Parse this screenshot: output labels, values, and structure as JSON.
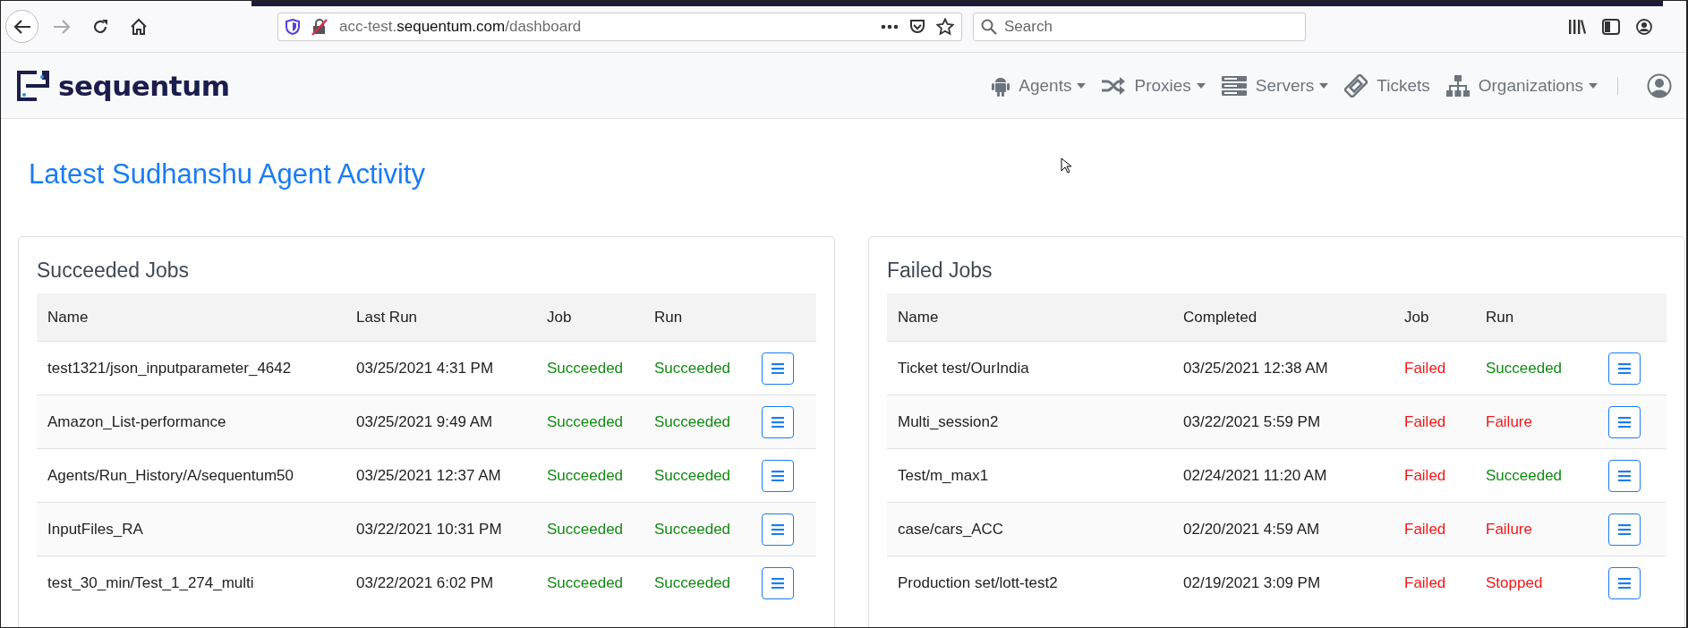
{
  "browser": {
    "url": {
      "prefix": "acc-test.",
      "domain": "sequentum.com",
      "path": "/dashboard"
    },
    "search": {
      "placeholder": "Search"
    }
  },
  "navbar": {
    "brand": "sequentum",
    "items": [
      {
        "label": "Agents",
        "dropdown": true
      },
      {
        "label": "Proxies",
        "dropdown": true
      },
      {
        "label": "Servers",
        "dropdown": true
      },
      {
        "label": "Tickets",
        "dropdown": false
      },
      {
        "label": "Organizations",
        "dropdown": true
      }
    ]
  },
  "page_title": "Latest Sudhanshu Agent Activity",
  "panels": [
    {
      "title": "Succeeded Jobs",
      "columns": [
        "Name",
        "Last Run",
        "Job",
        "Run"
      ],
      "rows": [
        {
          "name": "test1321/json_inputparameter_4642",
          "time": "03/25/2021 4:31 PM",
          "job": {
            "text": "Succeeded",
            "kind": "ok"
          },
          "run": {
            "text": "Succeeded",
            "kind": "ok"
          }
        },
        {
          "name": "Amazon_List-performance",
          "time": "03/25/2021 9:49 AM",
          "job": {
            "text": "Succeeded",
            "kind": "ok"
          },
          "run": {
            "text": "Succeeded",
            "kind": "ok"
          }
        },
        {
          "name": "Agents/Run_History/A/sequentum50",
          "time": "03/25/2021 12:37 AM",
          "job": {
            "text": "Succeeded",
            "kind": "ok"
          },
          "run": {
            "text": "Succeeded",
            "kind": "ok"
          }
        },
        {
          "name": "InputFiles_RA",
          "time": "03/22/2021 10:31 PM",
          "job": {
            "text": "Succeeded",
            "kind": "ok"
          },
          "run": {
            "text": "Succeeded",
            "kind": "ok"
          }
        },
        {
          "name": "test_30_min/Test_1_274_multi",
          "time": "03/22/2021 6:02 PM",
          "job": {
            "text": "Succeeded",
            "kind": "ok"
          },
          "run": {
            "text": "Succeeded",
            "kind": "ok"
          }
        }
      ]
    },
    {
      "title": "Failed Jobs",
      "columns": [
        "Name",
        "Completed",
        "Job",
        "Run"
      ],
      "rows": [
        {
          "name": "Ticket test/OurIndia",
          "time": "03/25/2021 12:38 AM",
          "job": {
            "text": "Failed",
            "kind": "fail"
          },
          "run": {
            "text": "Succeeded",
            "kind": "ok"
          }
        },
        {
          "name": "Multi_session2",
          "time": "03/22/2021 5:59 PM",
          "job": {
            "text": "Failed",
            "kind": "fail"
          },
          "run": {
            "text": "Failure",
            "kind": "fail"
          }
        },
        {
          "name": "Test/m_max1",
          "time": "02/24/2021 11:20 AM",
          "job": {
            "text": "Failed",
            "kind": "fail"
          },
          "run": {
            "text": "Succeeded",
            "kind": "ok"
          }
        },
        {
          "name": "case/cars_ACC",
          "time": "02/20/2021 4:59 AM",
          "job": {
            "text": "Failed",
            "kind": "fail"
          },
          "run": {
            "text": "Failure",
            "kind": "fail"
          }
        },
        {
          "name": "Production set/lott-test2",
          "time": "02/19/2021 3:09 PM",
          "job": {
            "text": "Failed",
            "kind": "fail"
          },
          "run": {
            "text": "Stopped",
            "kind": "fail"
          }
        }
      ]
    }
  ]
}
